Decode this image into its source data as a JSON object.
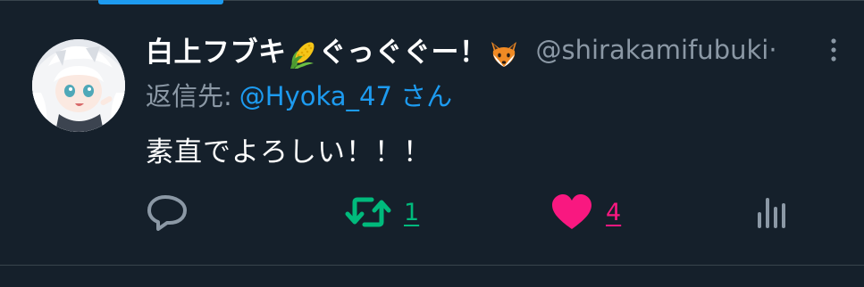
{
  "colors": {
    "background": "#15202b",
    "divider": "#38444d",
    "primary_text": "#ffffff",
    "secondary_text": "#8b98a5",
    "accent_blue": "#1d9bf0",
    "retweet_green": "#00ba7c",
    "like_pink": "#f91880",
    "icon_gray": "#8b98a5"
  },
  "tweet": {
    "display_name_part1": "白上フブキ",
    "display_name_part2": "ぐっぐぐー！",
    "name_emojis": [
      "corn-emoji",
      "fox-emoji"
    ],
    "handle": "@shirakamifubuki",
    "handle_ellipsis": "·",
    "reply_prefix": "返信先:",
    "reply_mention": "@Hyoka_47",
    "reply_suffix": "さん",
    "text": "素直でよろしい！！！",
    "actions": {
      "reply": {
        "icon": "reply-icon"
      },
      "retweet": {
        "icon": "retweet-icon",
        "count": "1"
      },
      "like": {
        "icon": "heart-icon",
        "count": "4",
        "liked": true
      },
      "analytics": {
        "icon": "analytics-icon"
      }
    }
  }
}
